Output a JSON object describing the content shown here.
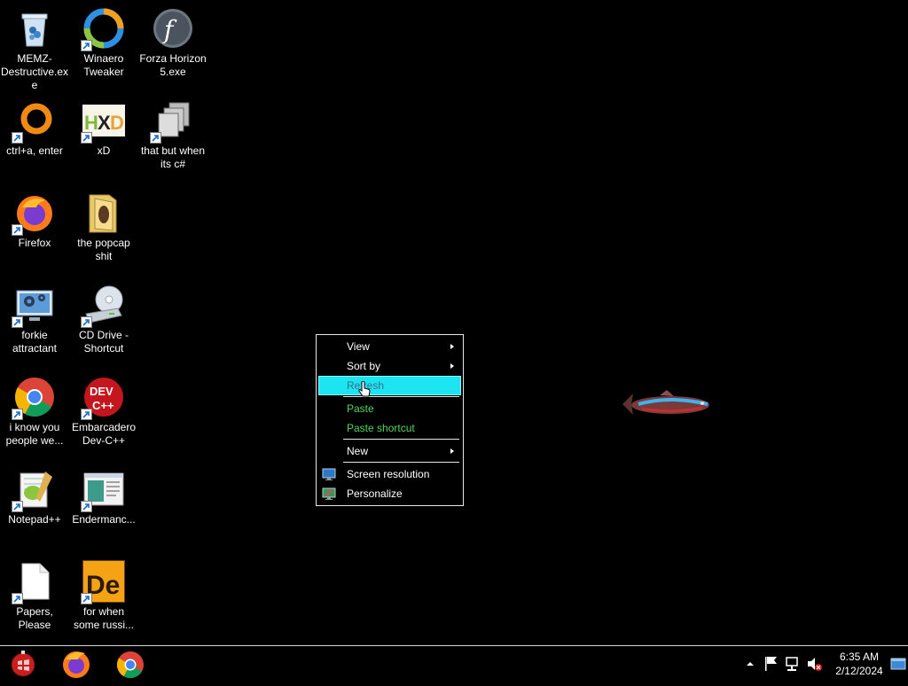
{
  "desktop": {
    "icons": [
      {
        "label": "MEMZ-Destructive.exe",
        "icon": "recycle-bin-icon"
      },
      {
        "label": "Winaero Tweaker",
        "icon": "winaero-icon"
      },
      {
        "label": "Forza Horizon 5.exe",
        "icon": "flash-icon"
      },
      {
        "label": "ctrl+a, enter",
        "icon": "orange-ring-icon"
      },
      {
        "label": "xD",
        "icon": "hxd-icon"
      },
      {
        "label": "that but when its c#",
        "icon": "stacked-windows-icon"
      },
      {
        "label": "Firefox",
        "icon": "firefox-icon"
      },
      {
        "label": "the popcap shit",
        "icon": "folder-icon"
      },
      {
        "label": "forkie attractant",
        "icon": "settings-monitor-icon"
      },
      {
        "label": "CD Drive - Shortcut",
        "icon": "cd-drive-icon"
      },
      {
        "label": "i know you people we...",
        "icon": "chrome-icon"
      },
      {
        "label": "Embarcadero Dev-C++",
        "icon": "devcpp-icon"
      },
      {
        "label": "Notepad++",
        "icon": "notepadpp-icon"
      },
      {
        "label": "Endermanc...",
        "icon": "window-app-icon"
      },
      {
        "label": "Papers, Please",
        "icon": "blank-file-icon"
      },
      {
        "label": "for when some russi...",
        "icon": "de-icon"
      }
    ]
  },
  "context_menu": {
    "view": "View",
    "sort_by": "Sort by",
    "refresh": "Refresh",
    "paste": "Paste",
    "paste_shortcut": "Paste shortcut",
    "new": "New",
    "screen_resolution": "Screen resolution",
    "personalize": "Personalize"
  },
  "taskbar": {
    "pinned": [
      "start-orb-icon",
      "firefox-icon",
      "chrome-icon"
    ],
    "tray_icons": [
      "show-hidden-icons",
      "action-center-flag-icon",
      "network-icon",
      "volume-muted-icon"
    ],
    "time": "6:35 AM",
    "date": "2/12/2024"
  },
  "colors": {
    "highlight": "#1de4f1",
    "green_text": "#56d45c",
    "background": "#000000"
  }
}
